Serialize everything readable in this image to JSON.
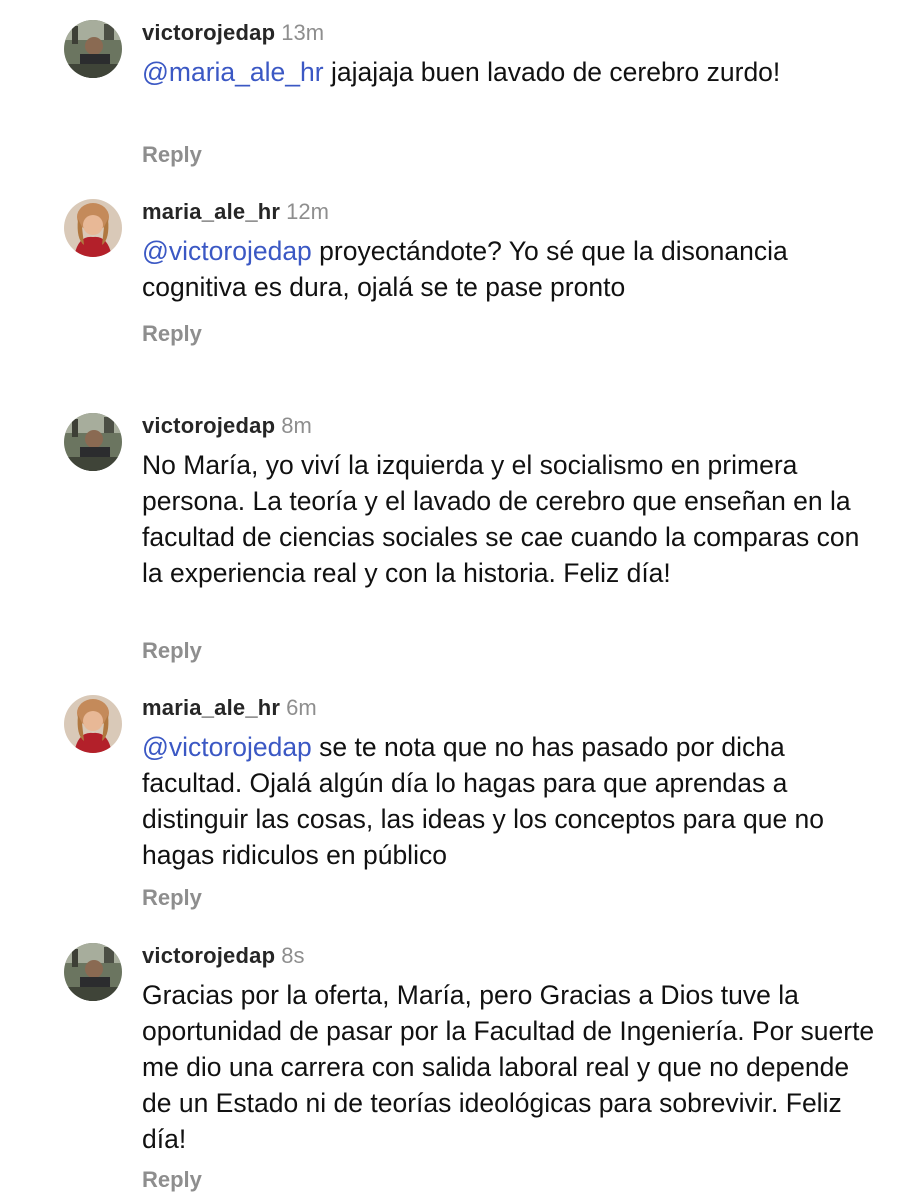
{
  "comments": [
    {
      "username": "victorojedap",
      "time": "13m",
      "mention": "@maria_ale_hr",
      "text": " jajajaja buen lavado de cerebro zurdo!",
      "reply_label": "Reply",
      "avatar_icon": "avatar-victorojedap"
    },
    {
      "username": "maria_ale_hr",
      "time": "12m",
      "mention": "@victorojedap",
      "text": " proyectándote? Yo sé que la disonancia cognitiva es dura, ojalá se te pase pronto",
      "reply_label": "Reply",
      "avatar_icon": "avatar-maria_ale_hr"
    },
    {
      "username": "victorojedap",
      "time": "8m",
      "mention": "",
      "text": "No María, yo viví la izquierda y el socialismo en primera persona. La teoría y el lavado de cerebro que enseñan en la facultad de ciencias sociales se cae cuando la comparas con la experiencia real y con la historia. Feliz día!",
      "reply_label": "Reply",
      "avatar_icon": "avatar-victorojedap"
    },
    {
      "username": "maria_ale_hr",
      "time": "6m",
      "mention": "@victorojedap",
      "text": " se te nota que no has pasado por dicha facultad. Ojalá algún día lo hagas para que aprendas a distinguir las cosas, las ideas y los conceptos para que no hagas ridiculos en público",
      "reply_label": "Reply",
      "avatar_icon": "avatar-maria_ale_hr"
    },
    {
      "username": "victorojedap",
      "time": "8s",
      "mention": "",
      "text": "Gracias por la oferta, María, pero Gracias a Dios tuve la oportunidad de pasar por la Facultad de Ingeniería. Por suerte me dio una carrera con salida laboral real y que no depende de un Estado ni de teorías ideológicas para sobrevivir. Feliz día!",
      "reply_label": "Reply",
      "avatar_icon": "avatar-victorojedap"
    }
  ],
  "colors": {
    "mention": "#3b58c4",
    "username": "#262626",
    "muted": "#8e8e8e",
    "text": "#111111"
  }
}
